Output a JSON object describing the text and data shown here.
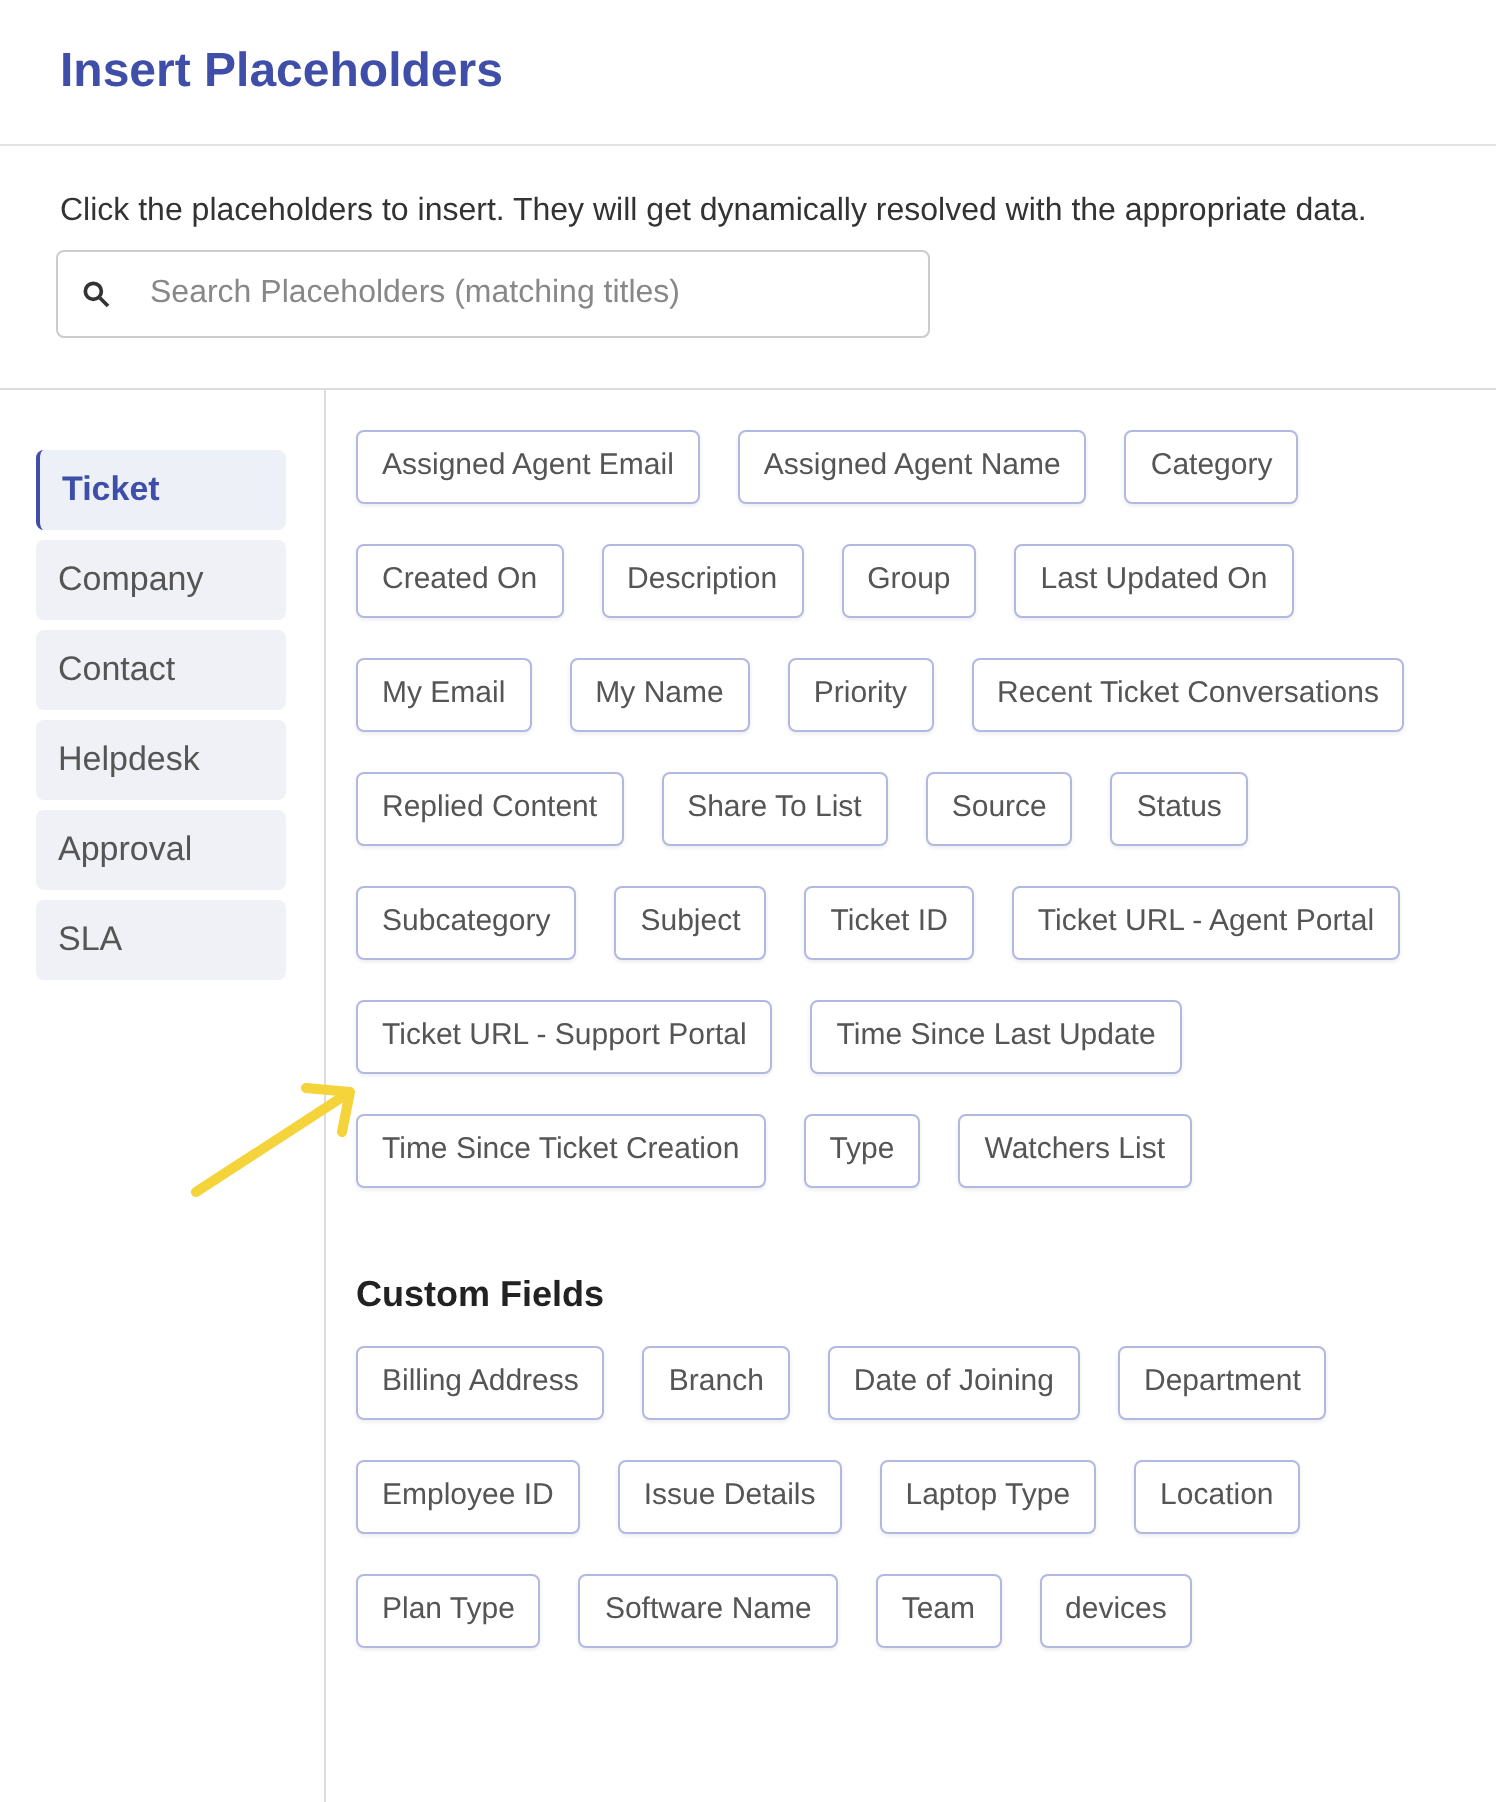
{
  "title": "Insert Placeholders",
  "description": "Click the placeholders to insert. They will get dynamically resolved with the appropriate data.",
  "search": {
    "placeholder": "Search Placeholders (matching titles)"
  },
  "categories": [
    {
      "label": "Ticket",
      "selected": true
    },
    {
      "label": "Company",
      "selected": false
    },
    {
      "label": "Contact",
      "selected": false
    },
    {
      "label": "Helpdesk",
      "selected": false
    },
    {
      "label": "Approval",
      "selected": false
    },
    {
      "label": "SLA",
      "selected": false
    }
  ],
  "placeholders": [
    "Assigned Agent Email",
    "Assigned Agent Name",
    "Category",
    "Created On",
    "Description",
    "Group",
    "Last Updated On",
    "My Email",
    "My Name",
    "Priority",
    "Recent Ticket Conversations",
    "Replied Content",
    "Share To List",
    "Source",
    "Status",
    "Subcategory",
    "Subject",
    "Ticket ID",
    "Ticket URL - Agent Portal",
    "Ticket URL - Support Portal",
    "Time Since Last Update",
    "Time Since Ticket Creation",
    "Type",
    "Watchers List"
  ],
  "custom_fields": {
    "heading": "Custom Fields",
    "items": [
      "Billing Address",
      "Branch",
      "Date of Joining",
      "Department",
      "Employee ID",
      "Issue Details",
      "Laptop Type",
      "Location",
      "Plan Type",
      "Software Name",
      "Team",
      "devices"
    ]
  }
}
